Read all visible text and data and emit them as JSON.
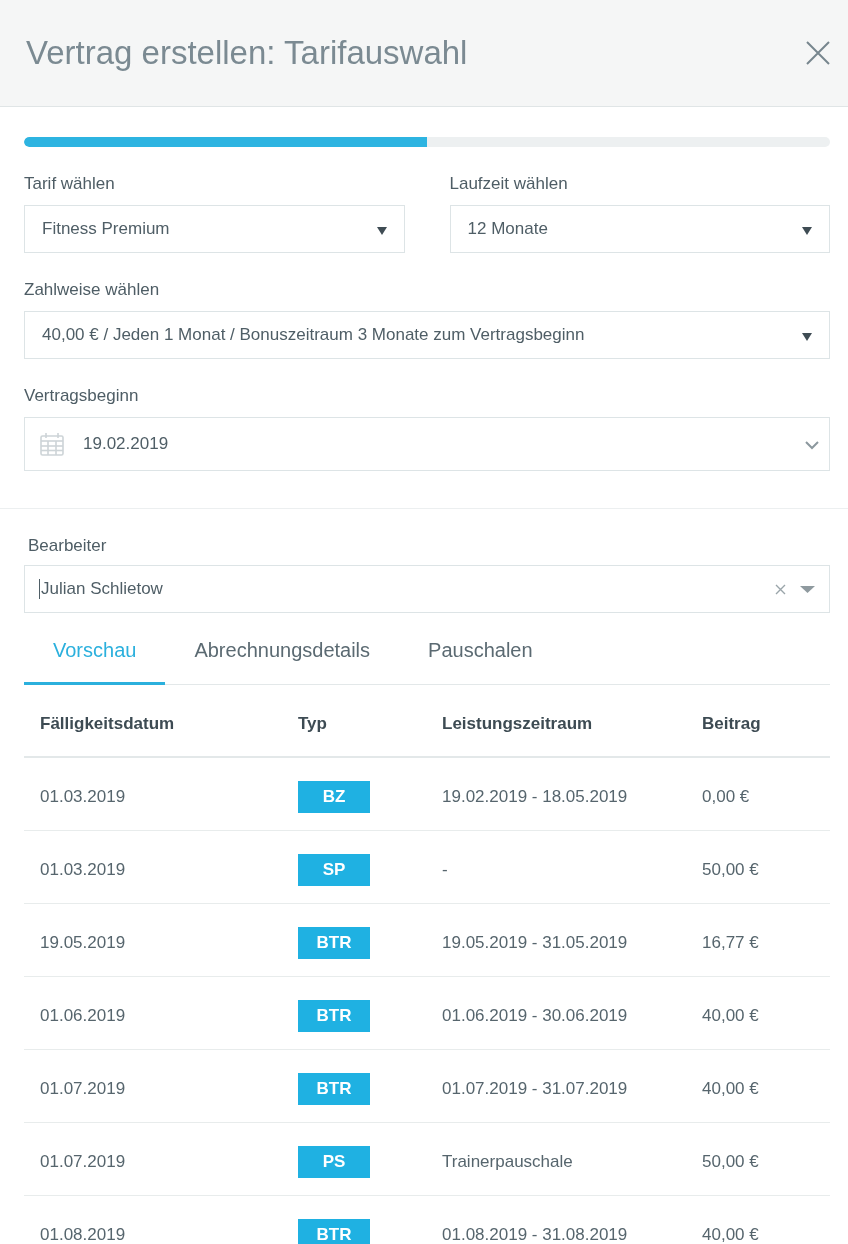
{
  "header": {
    "title": "Vertrag erstellen: Tarifauswahl"
  },
  "progress": {
    "level": 0.5
  },
  "contract_fields": [
    [
      {
        "kind": "select",
        "label": "Tarif wählen",
        "value": "Fitness Premium"
      },
      {
        "kind": "select",
        "label": "Laufzeit wählen",
        "value": "12 Monate"
      }
    ],
    [
      {
        "kind": "select",
        "label": "Zahlweise wählen",
        "value": "40,00 € / Jeden 1 Monat / Bonuszeitraum 3 Monate zum Vertragsbeginn"
      }
    ],
    [
      {
        "kind": "date",
        "label": "Vertragsbeginn",
        "value": "19.02.2019"
      }
    ]
  ],
  "editor_field": {
    "kind": "combobox",
    "label": "Bearbeiter",
    "value": "Julian Schlietow",
    "focused": true
  },
  "tabs": [
    {
      "label": "Vorschau",
      "selected": true
    },
    {
      "label": "Abrechnungsdetails",
      "selected": false
    },
    {
      "label": "Pauschalen",
      "selected": false
    }
  ],
  "table": {
    "columns": [
      "Fälligkeitsdatum",
      "Typ",
      "Leistungszeitraum",
      "Beitrag"
    ],
    "rows": [
      {
        "due_date": "01.03.2019",
        "type": "BZ",
        "period": "19.02.2019 - 18.05.2019",
        "amount": "0,00 €"
      },
      {
        "due_date": "01.03.2019",
        "type": "SP",
        "period": "-",
        "amount": "50,00 €"
      },
      {
        "due_date": "19.05.2019",
        "type": "BTR",
        "period": "19.05.2019 - 31.05.2019",
        "amount": "16,77 €"
      },
      {
        "due_date": "01.06.2019",
        "type": "BTR",
        "period": "01.06.2019 - 30.06.2019",
        "amount": "40,00 €"
      },
      {
        "due_date": "01.07.2019",
        "type": "BTR",
        "period": "01.07.2019 - 31.07.2019",
        "amount": "40,00 €"
      },
      {
        "due_date": "01.07.2019",
        "type": "PS",
        "period": "Trainerpauschale",
        "amount": "50,00 €"
      },
      {
        "due_date": "01.08.2019",
        "type": "BTR",
        "period": "01.08.2019 - 31.08.2019",
        "amount": "40,00 €"
      }
    ]
  }
}
